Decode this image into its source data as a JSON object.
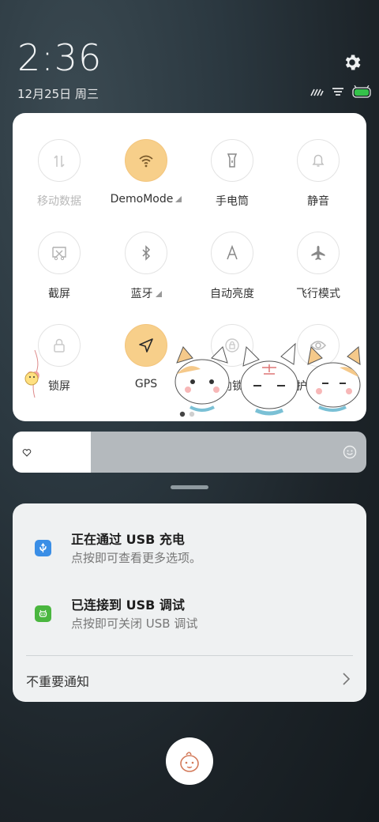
{
  "status": {
    "time": "2:36",
    "date": "12月25日 周三",
    "battery_color": "#35c24a"
  },
  "quick_settings": {
    "tiles": [
      {
        "id": "mobile-data",
        "label": "移动数据",
        "icon": "mobile-data-icon",
        "enabled": false
      },
      {
        "id": "demomode",
        "label": "DemoMode",
        "icon": "wifi-icon",
        "enabled": true,
        "has_menu": true
      },
      {
        "id": "flashlight",
        "label": "手电筒",
        "icon": "flashlight-icon",
        "enabled": false
      },
      {
        "id": "mute",
        "label": "静音",
        "icon": "bell-icon",
        "enabled": false
      },
      {
        "id": "screenshot",
        "label": "截屏",
        "icon": "screenshot-icon",
        "enabled": false
      },
      {
        "id": "bluetooth",
        "label": "蓝牙",
        "icon": "bluetooth-icon",
        "enabled": false,
        "has_menu": true
      },
      {
        "id": "auto-brightness",
        "label": "自动亮度",
        "icon": "auto-brightness-icon",
        "enabled": false
      },
      {
        "id": "airplane",
        "label": "飞行模式",
        "icon": "airplane-icon",
        "enabled": false
      },
      {
        "id": "lock-screen",
        "label": "锁屏",
        "icon": "lock-icon",
        "enabled": false
      },
      {
        "id": "gps",
        "label": "GPS",
        "icon": "location-arrow-icon",
        "enabled": true
      },
      {
        "id": "rotation-lock",
        "label": "方向锁定",
        "icon": "rotation-lock-icon",
        "enabled": false
      },
      {
        "id": "eye-care",
        "label": "护眼模式",
        "icon": "eye-icon",
        "enabled": false
      }
    ],
    "page_index": 0
  },
  "brightness": {
    "level": 0.22,
    "icon": "face-icon"
  },
  "notifications": [
    {
      "title": "正在通过 USB 充电",
      "body": "点按即可查看更多选项。",
      "icon": "usb-icon",
      "icon_color": "#3a8ee6"
    },
    {
      "title": "已连接到 USB 调试",
      "body": "点按即可关闭 USB 调试",
      "icon": "android-icon",
      "icon_color": "#4ab63f"
    }
  ],
  "unimportant_label": "不重要通知"
}
